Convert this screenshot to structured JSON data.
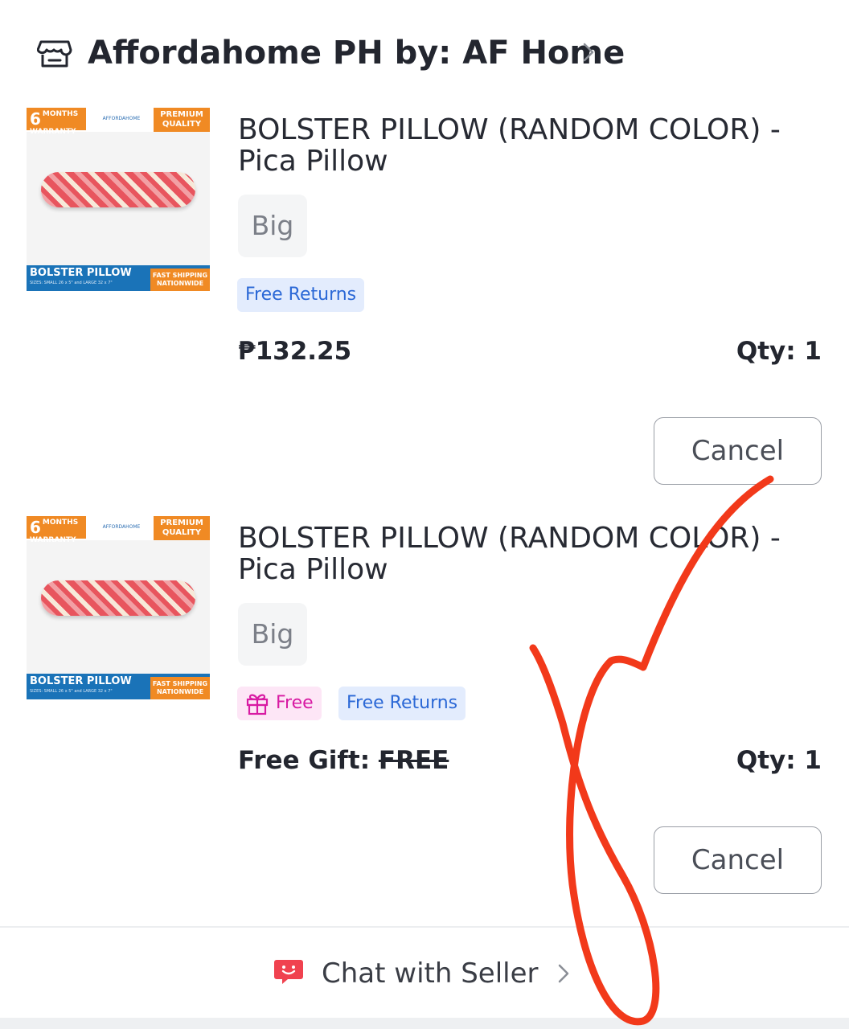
{
  "store": {
    "name": "Affordahome PH by: AF Home",
    "icon": "store-icon"
  },
  "items": [
    {
      "image": {
        "warranty_num": "6",
        "warranty_text": "MONTHS WARRANTY",
        "brand": "AFFORDAHOME",
        "quality": "PREMIUM QUALITY",
        "label": "BOLSTER PILLOW",
        "sizes": "SIZES: SMALL 26 x 5\" and LARGE 32 x 7\"",
        "shipping": "FAST SHIPPING NATIONWIDE"
      },
      "title": "BOLSTER PILLOW (RANDOM COLOR) - Pica Pillow",
      "variant": "Big",
      "tags": [
        "Free Returns"
      ],
      "price": "₱132.25",
      "qty": "Qty: 1",
      "cancel_label": "Cancel"
    },
    {
      "image": {
        "warranty_num": "6",
        "warranty_text": "MONTHS WARRANTY",
        "brand": "AFFORDAHOME",
        "quality": "PREMIUM QUALITY",
        "label": "BOLSTER PILLOW",
        "sizes": "SIZES: SMALL 26 x 5\" and LARGE 32 x 7\"",
        "shipping": "FAST SHIPPING NATIONWIDE"
      },
      "title": "BOLSTER PILLOW (RANDOM COLOR) - Pica Pillow",
      "variant": "Big",
      "gift_tag": "Free",
      "tags": [
        "Free Returns"
      ],
      "price_label": "Free Gift: ",
      "price_struck": "FREE",
      "qty": "Qty: 1",
      "cancel_label": "Cancel"
    }
  ],
  "footer": {
    "chat_label": "Chat with Seller",
    "chat_icon": "chat-smile-icon"
  },
  "colors": {
    "return_tag_bg": "#e3ecfd",
    "return_tag_text": "#2b68d6",
    "gift_tag_bg": "#fde6f6",
    "gift_tag_text": "#d81ba3",
    "chat_icon": "#f0424f",
    "scribble": "#f2391a"
  }
}
